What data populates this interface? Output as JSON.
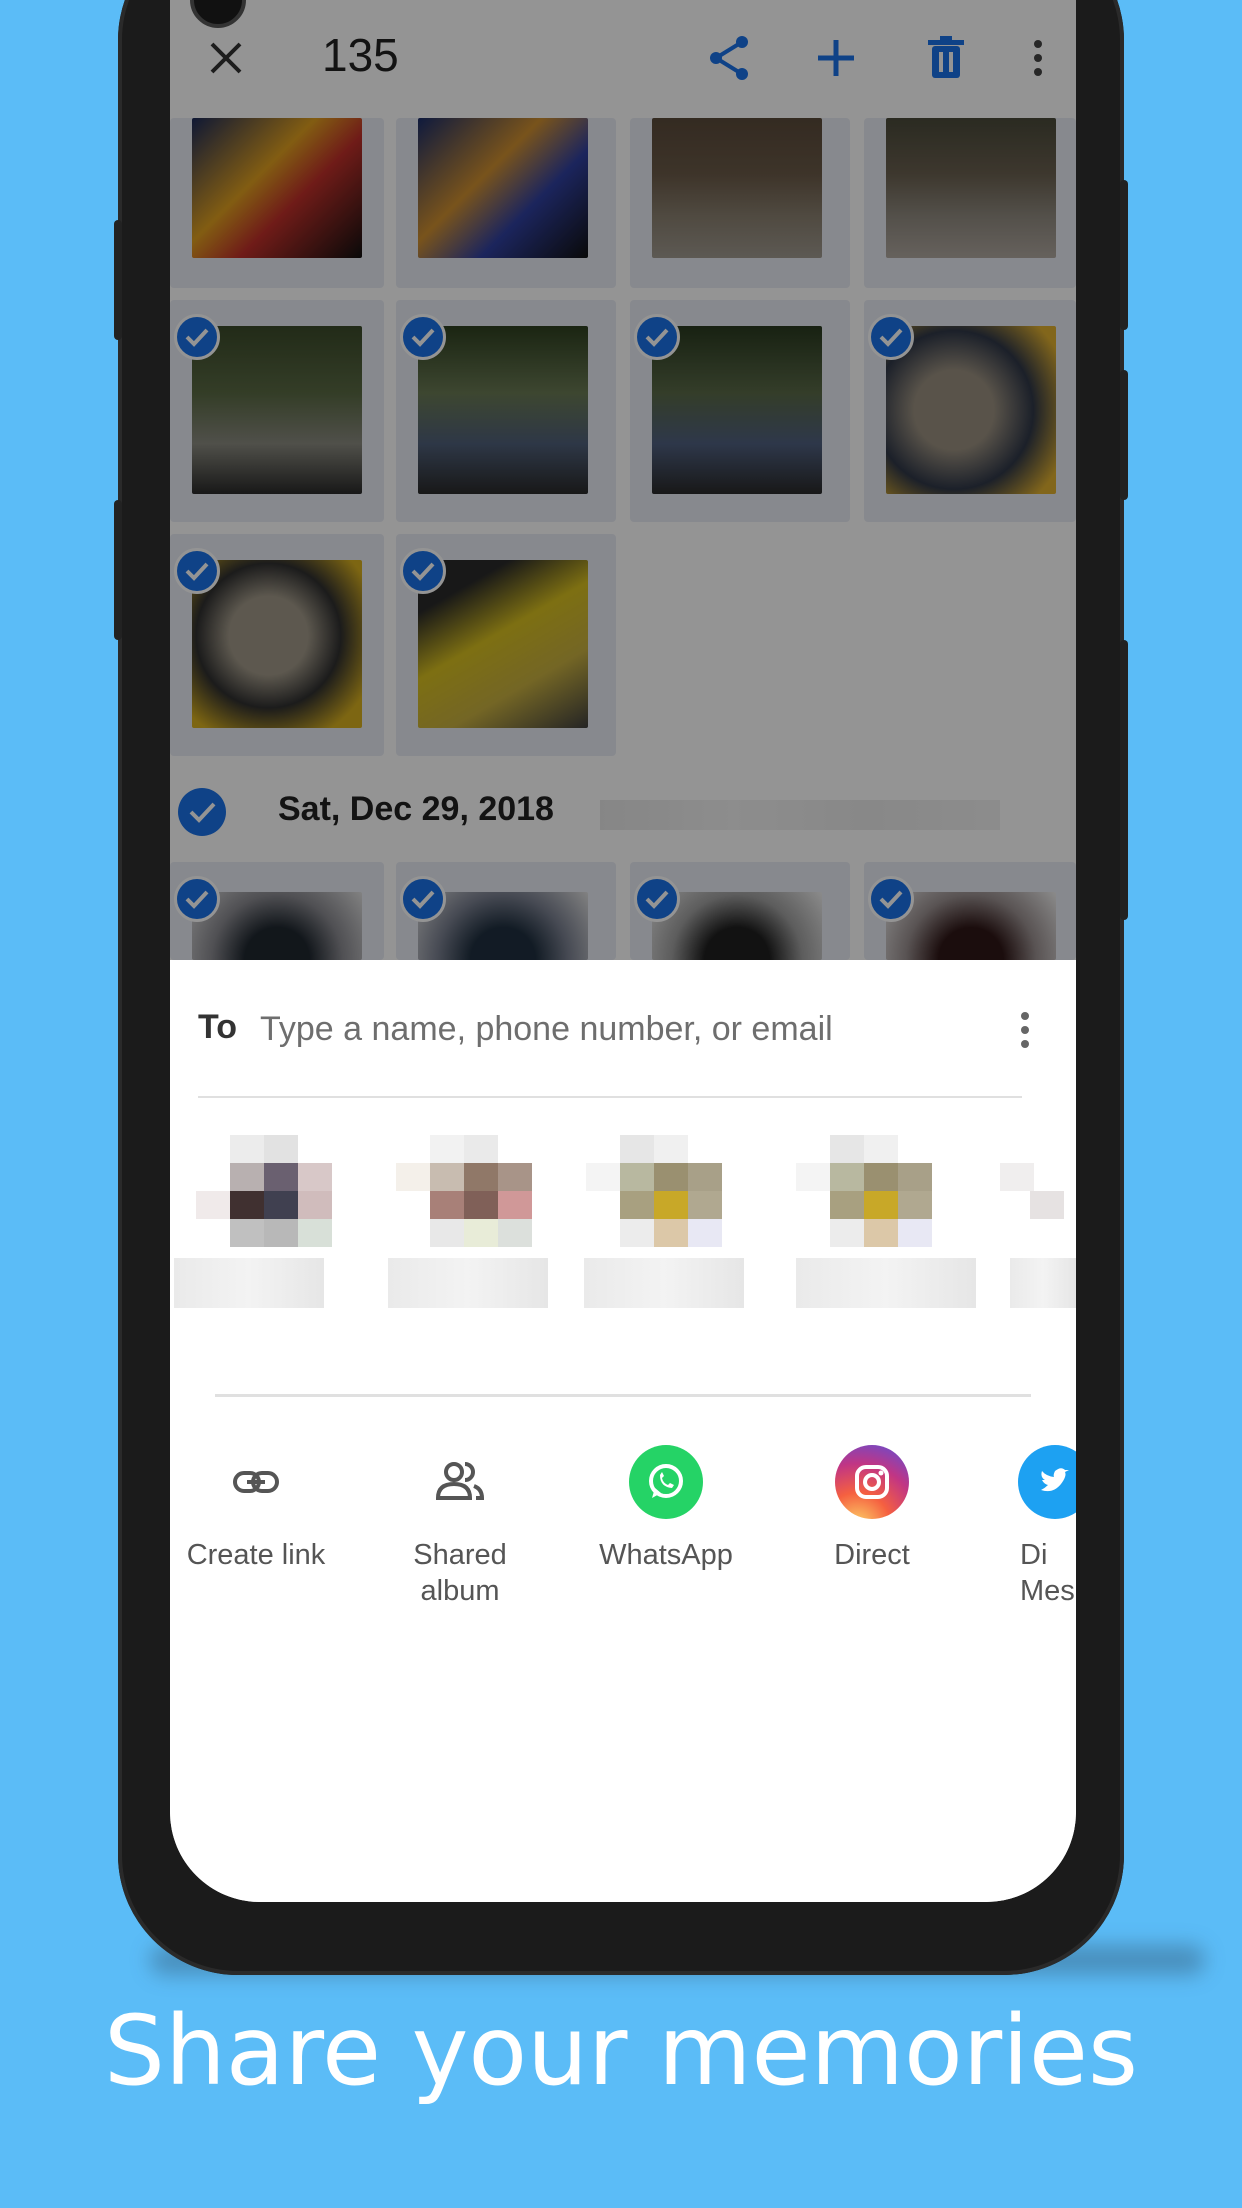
{
  "topbar": {
    "selected_count": "135",
    "close_icon": "close-icon",
    "share_icon": "share-icon",
    "add_icon": "add-icon",
    "delete_icon": "delete-icon",
    "more_icon": "more-vert-icon"
  },
  "gallery": {
    "date_header": "Sat, Dec 29, 2018"
  },
  "share_sheet": {
    "to_label": "To",
    "to_placeholder": "Type a name, phone number, or email",
    "apps": [
      {
        "label_line1": "Create link",
        "label_line2": "",
        "icon": "link-icon"
      },
      {
        "label_line1": "Shared",
        "label_line2": "album",
        "icon": "people-icon"
      },
      {
        "label_line1": "WhatsApp",
        "label_line2": "",
        "icon": "whatsapp-icon"
      },
      {
        "label_line1": "Direct",
        "label_line2": "",
        "icon": "instagram-icon"
      },
      {
        "label_line1": "Di",
        "label_line2": "Mes",
        "icon": "twitter-icon"
      }
    ]
  },
  "caption": "Share your memories",
  "colors": {
    "background": "#5bbcf7",
    "accent": "#1a73e8",
    "whatsapp": "#25d366"
  }
}
